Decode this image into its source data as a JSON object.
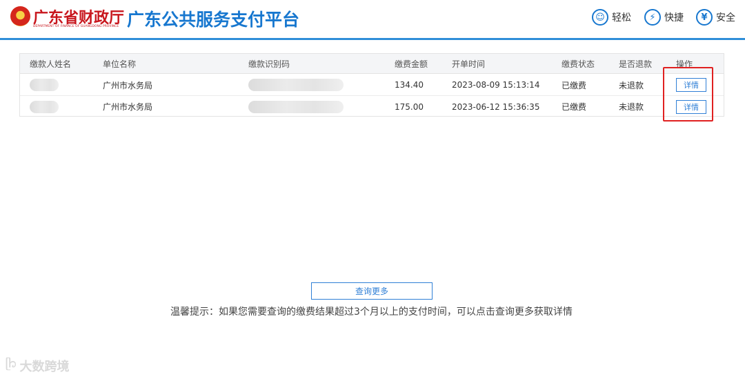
{
  "header": {
    "logo_cn": "广东省财政厅",
    "logo_en": "DEPARTMENT OF FINANCE OF GUANGDONG PROVINCE",
    "title": "广东公共服务支付平台",
    "features": [
      {
        "icon": "smile-icon",
        "glyph": "☺",
        "label": "轻松"
      },
      {
        "icon": "lightning-icon",
        "glyph": "⚡",
        "label": "快捷"
      },
      {
        "icon": "shield-yen-icon",
        "glyph": "¥",
        "label": "安全"
      }
    ],
    "accent_color": "#1777cf"
  },
  "table": {
    "columns": [
      "缴款人姓名",
      "单位名称",
      "缴款识别码",
      "缴费金额",
      "开单时间",
      "缴费状态",
      "是否退款",
      "操作"
    ],
    "rows": [
      {
        "payer": "",
        "unit": "广州市水务局",
        "code": "",
        "amount": "134.40",
        "time": "2023-08-09 15:13:14",
        "status": "已缴费",
        "refund": "未退款",
        "action": "详情"
      },
      {
        "payer": "",
        "unit": "广州市水务局",
        "code": "",
        "amount": "175.00",
        "time": "2023-06-12 15:36:35",
        "status": "已缴费",
        "refund": "未退款",
        "action": "详情"
      }
    ]
  },
  "more_button": "查询更多",
  "tip": "温馨提示：如果您需要查询的缴费结果超过3个月以上的支付时间，可以点击查询更多获取详情",
  "watermark": {
    "icon": "chat-bubble-icon",
    "text": "大数跨境"
  }
}
